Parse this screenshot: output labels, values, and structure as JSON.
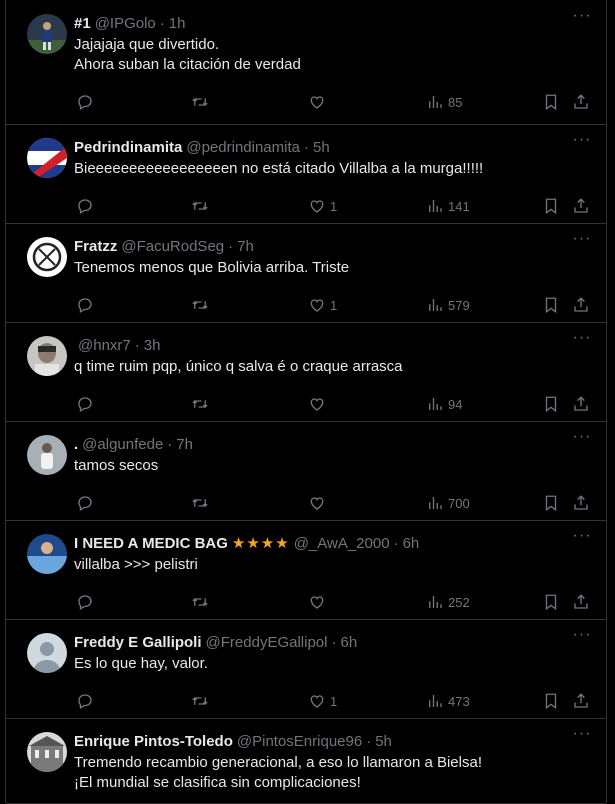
{
  "tweets": [
    {
      "name": "#1",
      "handle": "@IPGolo",
      "time": "1h",
      "text": "Jajajaja que divertido.\nAhora suban la citación de verdad",
      "likes": "",
      "views": "85",
      "avatar": "player",
      "stars": ""
    },
    {
      "name": "Pedrindinamita",
      "handle": "@pedrindinamita",
      "time": "5h",
      "text": "Bieeeeeeeeeeeeeeeeen no está citado Villalba a la murga!!!!!",
      "likes": "1",
      "views": "141",
      "avatar": "flag",
      "stars": ""
    },
    {
      "name": "Fratzz",
      "handle": "@FacuRodSeg",
      "time": "7h",
      "text": "Tenemos menos que Bolivia arriba. Triste",
      "likes": "1",
      "views": "579",
      "avatar": "circle",
      "stars": ""
    },
    {
      "name": "",
      "handle": "@hnxr7",
      "time": "3h",
      "text": "q time ruim pqp, único q salva é o craque arrasca",
      "likes": "",
      "views": "94",
      "avatar": "photo",
      "stars": ""
    },
    {
      "name": ".",
      "handle": "@algunfede",
      "time": "7h",
      "text": "tamos secos",
      "likes": "",
      "views": "700",
      "avatar": "person",
      "stars": ""
    },
    {
      "name": "I NEED A MEDIC BAG",
      "handle": "@_AwA_2000",
      "time": "6h",
      "text": "villalba >>> pelistri",
      "likes": "",
      "views": "252",
      "avatar": "blue",
      "stars": "★★★★"
    },
    {
      "name": "Freddy E Gallipoli",
      "handle": "@FreddyEGallipol",
      "time": "6h",
      "text": "Es lo que hay, valor.",
      "likes": "1",
      "views": "473",
      "avatar": "default",
      "stars": ""
    },
    {
      "name": "Enrique Pintos-Toledo",
      "handle": "@PintosEnrique96",
      "time": "5h",
      "text": "Tremendo recambio generacional, a eso lo llamaron a Bielsa!\n¡El mundial se clasifica sin complicaciones!",
      "likes": "",
      "views": "",
      "avatar": "building",
      "stars": ""
    }
  ],
  "icons": {
    "reply": "reply-icon",
    "retweet": "retweet-icon",
    "like": "like-icon",
    "views": "views-icon",
    "bookmark": "bookmark-icon",
    "share": "share-icon",
    "more": "more-icon"
  },
  "colors": {
    "background": "#000000",
    "border": "#2f3336",
    "text": "#e7e9ea",
    "muted": "#71767b",
    "star": "#f4a522"
  }
}
